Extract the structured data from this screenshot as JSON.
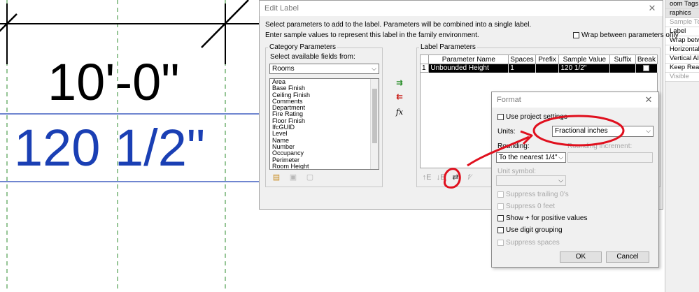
{
  "canvas": {
    "dim_value": "10'-0\"",
    "label_value": "120 1/2\""
  },
  "properties": {
    "rows": [
      "oom Tags :",
      "raphics",
      "Sample Tex",
      "Label",
      "Wrap betw",
      "Horizontal A",
      "Vertical Alig",
      "Keep Reada",
      "Visible"
    ]
  },
  "edit_label": {
    "title": "Edit Label",
    "close": "✕",
    "instruction1": "Select parameters to add to the label.  Parameters will be combined into a single label.",
    "instruction2": "Enter sample values to represent this label in the family environment.",
    "wrap_option": "Wrap between parameters only",
    "category": {
      "group_label": "Category Parameters",
      "fields_label": "Select available fields from:",
      "selected": "Rooms",
      "items": [
        "Area",
        "Base Finish",
        "Ceiling Finish",
        "Comments",
        "Department",
        "Fire Rating",
        "Floor Finish",
        "IfcGUID",
        "Level",
        "Name",
        "Number",
        "Occupancy",
        "Perimeter",
        "Room Height"
      ]
    },
    "label_params": {
      "group_label": "Label Parameters",
      "columns": [
        "",
        "Parameter Name",
        "Spaces",
        "Prefix",
        "Sample Value",
        "Suffix",
        "Break"
      ],
      "row": {
        "num": "1",
        "name": "Unbounded Height",
        "spaces": "1",
        "prefix": "",
        "sample": "120 1/2\"",
        "suffix": ""
      }
    },
    "icons": {
      "fx": "fx"
    }
  },
  "format": {
    "title": "Format",
    "close": "✕",
    "use_project_settings": "Use project settings",
    "units_label": "Units:",
    "units_value": "Fractional inches",
    "rounding_label": "Rounding:",
    "rounding_value": "To the nearest 1/4\"",
    "rounding_increment_label": "Rounding increment:",
    "unit_symbol_label": "Unit symbol:",
    "suppress_trailing": "Suppress trailing 0's",
    "suppress_zero_feet": "Suppress 0 feet",
    "show_plus": "Show + for positive values",
    "digit_grouping": "Use digit grouping",
    "suppress_spaces": "Suppress spaces",
    "ok": "OK",
    "cancel": "Cancel"
  },
  "colors": {
    "accent_blue": "#1a3fb4",
    "annotation_red": "#e0101e",
    "ref_green": "#2e8b2e"
  }
}
